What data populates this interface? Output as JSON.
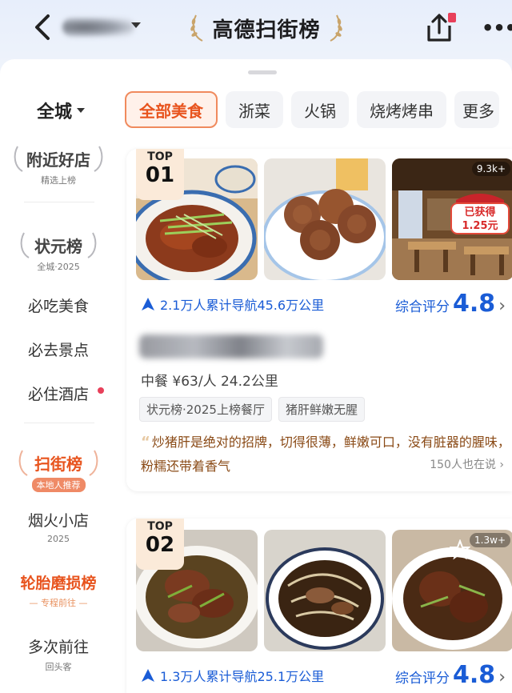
{
  "header": {
    "title": "高德扫街榜",
    "more_glyph": "•••"
  },
  "filters": {
    "city": "全城",
    "tabs": [
      "全部美食",
      "浙菜",
      "火锅",
      "烧烤烤串",
      "更多"
    ]
  },
  "sidebar": {
    "nearby": {
      "title": "附近好店",
      "sub": "精选上榜"
    },
    "champion": {
      "title": "状元榜",
      "sub": "全城·2025"
    },
    "items": [
      "必吃美食",
      "必去景点",
      "必住酒店"
    ],
    "street": {
      "title": "扫街榜",
      "sub": "本地人推荐"
    },
    "small_shop": {
      "title": "烟火小店",
      "sub": "2025"
    },
    "tire": {
      "title": "轮胎磨损榜",
      "sub": "— 专程前往 —"
    },
    "repeat": {
      "title": "多次前往",
      "sub": "回头客"
    }
  },
  "cards": [
    {
      "rank_label": "TOP",
      "rank": "01",
      "photo_badge": "9.3k+",
      "promo_text": [
        "已获得",
        "1.25元"
      ],
      "nav_text": "2.1万人累计导航45.6万公里",
      "score_label": "综合评分",
      "score": "4.8",
      "meta": "中餐 ¥63/人 24.2公里",
      "chips": [
        "状元榜·2025上榜餐厅",
        "猪肝鲜嫩无腥"
      ],
      "quote": "炒猪肝是绝对的招牌，切得很薄，鲜嫩可口，没有脏器的腥味，粉糯还带着香气",
      "also": "150人也在说 ›"
    },
    {
      "rank_label": "TOP",
      "rank": "02",
      "photo_badge": "1.3w+",
      "nav_text": "1.3万人累计导航25.1万公里",
      "score_label": "综合评分",
      "score": "4.8"
    }
  ],
  "colors": {
    "accent_orange": "#e8541e",
    "nav_blue": "#1a5cd6",
    "quote_brown": "#8a4a16",
    "red_dot": "#e8405a"
  }
}
